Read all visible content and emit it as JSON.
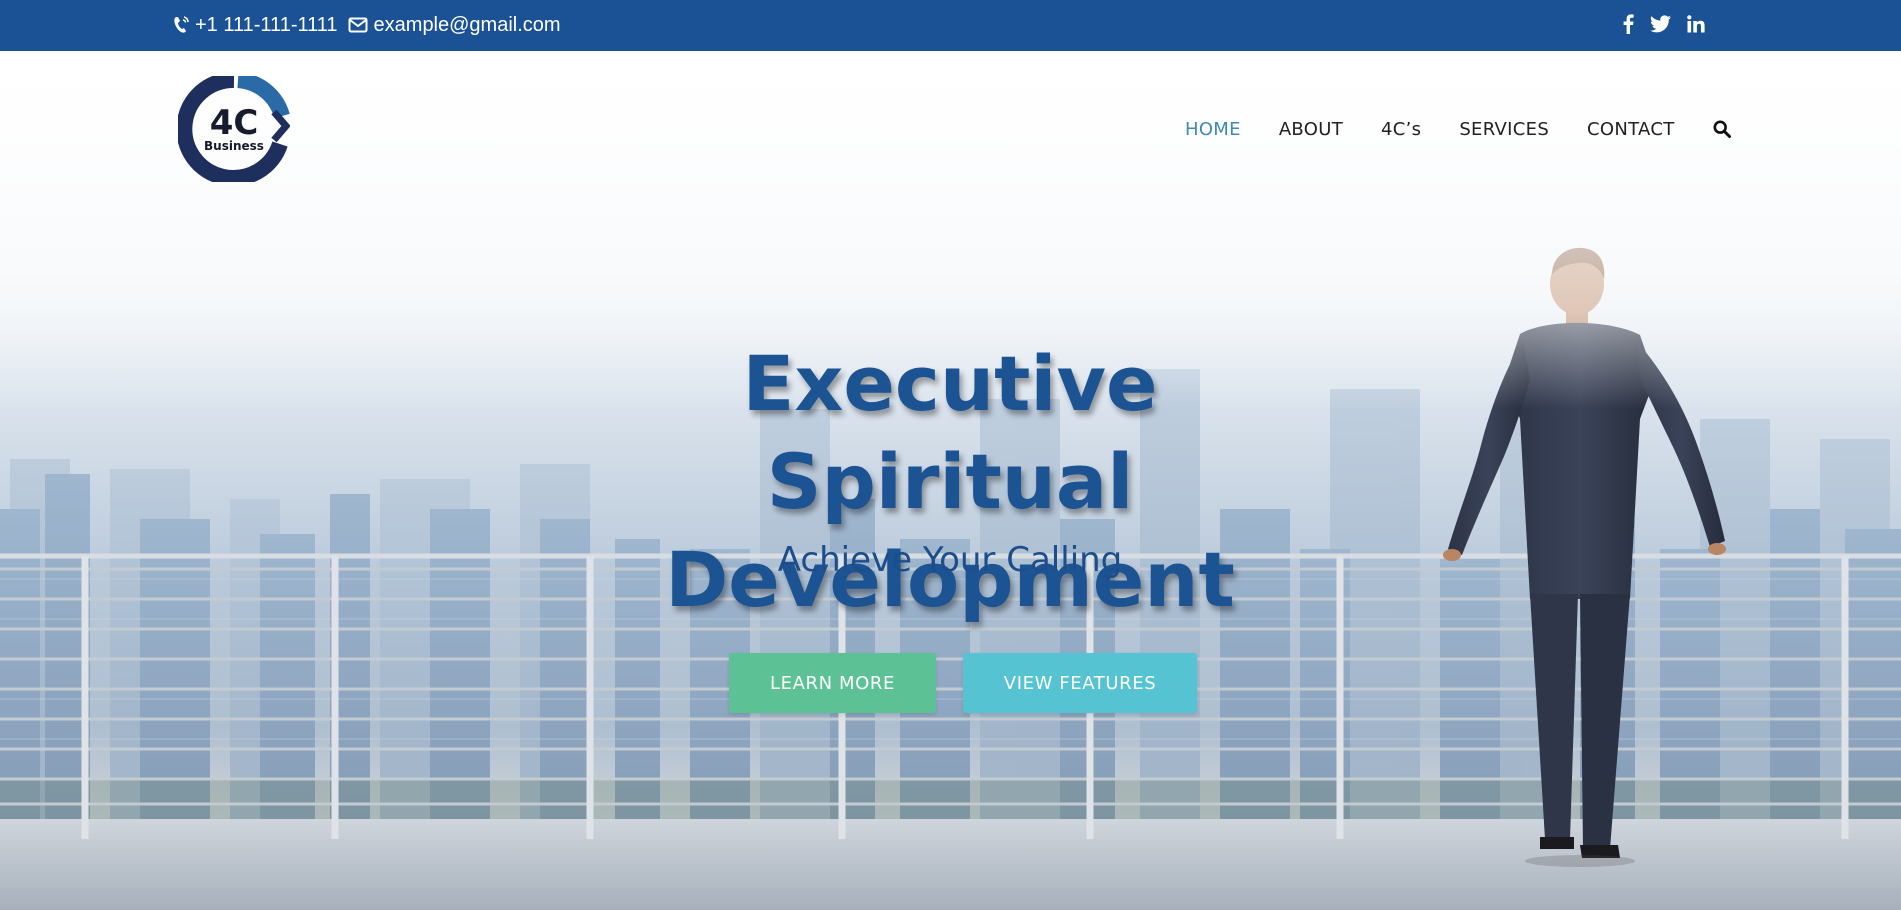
{
  "topbar": {
    "phone": "+1 111-111-1111",
    "email": "example@gmail.com",
    "social": [
      "facebook-icon",
      "twitter-icon",
      "linkedin-icon"
    ],
    "background": "#1b5295"
  },
  "logo": {
    "line1": "4C",
    "line2": "Business"
  },
  "nav": {
    "items": [
      "HOME",
      "ABOUT",
      "4C’s",
      "SERVICES",
      "CONTACT"
    ],
    "active": "HOME",
    "active_color": "#3f8ab5",
    "search_icon": "search-icon"
  },
  "hero": {
    "headline_line1": "Executive Spiritual",
    "headline_line2": "Development",
    "subheadline": "Achieve Your Calling",
    "headline_color": "#1c5393",
    "buttons": {
      "learn_more": "LEARN MORE",
      "view_features": "VIEW FEATURES"
    },
    "button_colors": {
      "learn_more": "#5cc295",
      "view_features": "#56c3d3"
    }
  }
}
